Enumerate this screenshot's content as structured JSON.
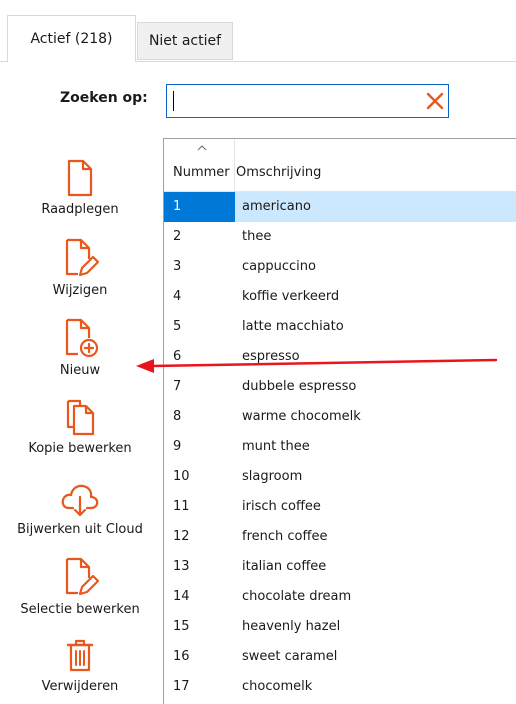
{
  "tabs": [
    {
      "label": "Actief (218)",
      "active": true
    },
    {
      "label": "Niet actief",
      "active": false
    }
  ],
  "search": {
    "label": "Zoeken op:",
    "value": "",
    "placeholder": ""
  },
  "actions": [
    {
      "label": "Raadplegen",
      "icon": "document-icon"
    },
    {
      "label": "Wijzigen",
      "icon": "document-edit-icon"
    },
    {
      "label": "Nieuw",
      "icon": "document-add-icon"
    },
    {
      "label": "Kopie bewerken",
      "icon": "copy-icon"
    },
    {
      "label": "Bijwerken uit Cloud",
      "icon": "cloud-download-icon"
    },
    {
      "label": "Selectie bewerken",
      "icon": "document-edit-icon"
    },
    {
      "label": "Verwijderen",
      "icon": "trash-icon"
    }
  ],
  "grid": {
    "columns": [
      "Nummer",
      "Omschrijving"
    ],
    "selected_row": 0,
    "rows": [
      [
        "1",
        "americano"
      ],
      [
        "2",
        "thee"
      ],
      [
        "3",
        "cappuccino"
      ],
      [
        "4",
        "koffie verkeerd"
      ],
      [
        "5",
        "latte macchiato"
      ],
      [
        "6",
        "espresso"
      ],
      [
        "7",
        "dubbele espresso"
      ],
      [
        "8",
        "warme chocomelk"
      ],
      [
        "9",
        "munt thee"
      ],
      [
        "10",
        "slagroom"
      ],
      [
        "11",
        "irisch coffee"
      ],
      [
        "12",
        "french coffee"
      ],
      [
        "13",
        "italian coffee"
      ],
      [
        "14",
        "chocolate dream"
      ],
      [
        "15",
        "heavenly hazel"
      ],
      [
        "16",
        "sweet caramel"
      ],
      [
        "17",
        "chocomelk"
      ]
    ]
  },
  "colors": {
    "accent": "#e8581c",
    "selection": "#cce8ff",
    "selection_strong": "#0078d7",
    "annotation": "#e8161c"
  }
}
